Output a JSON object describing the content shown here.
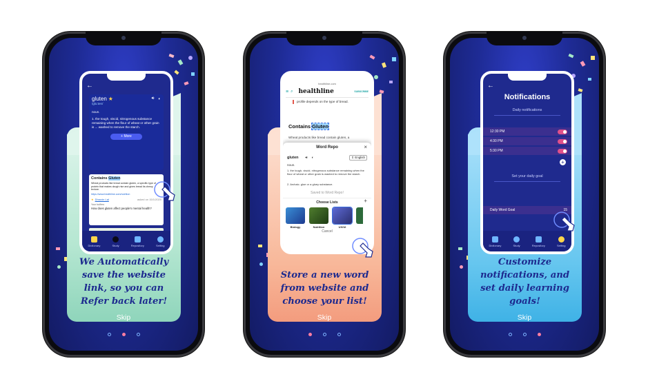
{
  "screens": [
    {
      "caption": "We Automatically save the website link, so you can Refer back later!",
      "skip": "Skip",
      "active_dot": 2,
      "inner": {
        "word": "gluten",
        "pronunciation": "/glu:ten/",
        "pos": "noun.",
        "definition": "1. the tough, viscid, nitrogenous substance remaining when the flour of wheat or other grain is ... washed to remove the starch.",
        "more_label": "+ More",
        "snippet_title": "Contains Gluten",
        "snippet_highlight": "Gluten",
        "snippet_text": "Wheat products like bread contain gluten, a specific type of protein that makes dough rise and gives bread its chewy texture.",
        "link_text": "https://www.healthline.com/nutrition",
        "user_name": "Dhruvin Lal",
        "user_date": "asked on 15/1/2020",
        "question_label": "Your buffers",
        "question": "How does gluten affect people's mental health?",
        "tabs": [
          "Dictionary",
          "Study",
          "Repository",
          "Setting"
        ]
      }
    },
    {
      "caption": "Store a new word from website and choose your list!",
      "skip": "Skip",
      "active_dot": 1,
      "inner": {
        "url": "healthline.com",
        "site_logo": "healthline",
        "site_nav": "SUBSCRIBE",
        "article_intro": "profile depends on the type of bread.",
        "heading": "Contains Gluten",
        "heading_highlight": "Gluten",
        "paragraph": "Wheat products like bread contain gluten, a",
        "dialog_title": "Word Repo",
        "word": "gluten",
        "language": "English",
        "pos": "noun.",
        "definition": "1. the tough, viscid, nitrogenous substance remaining when the flour of wheat or other grain is washed to remove the starch.",
        "definition2": "2. Archaic. glue or a gluey substance.",
        "saved": "Saved to Word Repo!",
        "choose_lists": "Choose Lists",
        "lists": [
          "Biology",
          "Nutrition",
          "UX/UI"
        ],
        "cancel": "Cancel"
      }
    },
    {
      "caption": "Customize notifications, and set daily learning goals!",
      "skip": "Skip",
      "active_dot": 3,
      "inner": {
        "title": "Notifications",
        "daily_label": "Daily notifications",
        "times": [
          "12:30 PM",
          "4:30 PM",
          "5:30 PM"
        ],
        "goal_label": "Set your daily goal",
        "goal_row_label": "Daily Word Goal",
        "goal_value": "15",
        "tabs": [
          "Dictionary",
          "Study",
          "Repository",
          "Setting"
        ]
      }
    }
  ],
  "colors": {
    "caption": "#1d2a8f",
    "accent_pink": "#ff7ea2",
    "toggle_pink": "#e0508a"
  }
}
